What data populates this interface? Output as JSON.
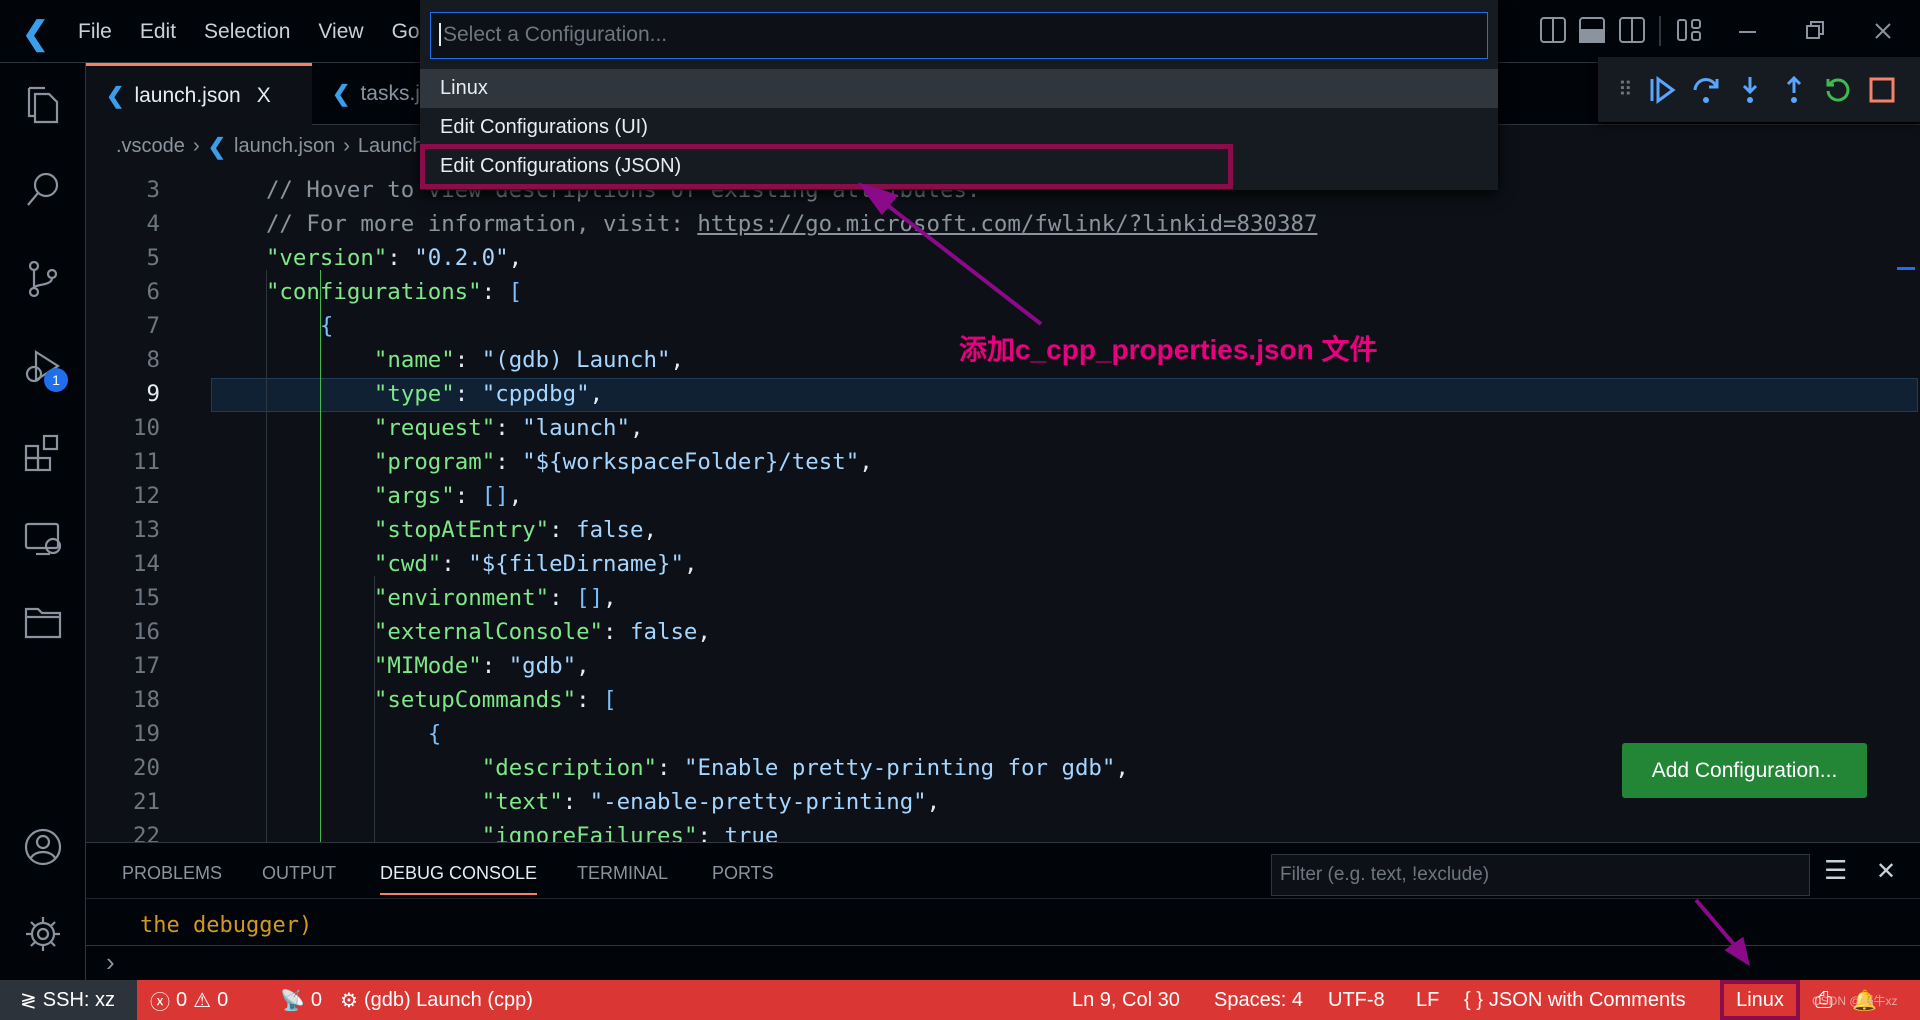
{
  "titlebar": {
    "menu": [
      "File",
      "Edit",
      "Selection",
      "View",
      "Go"
    ]
  },
  "tabs": [
    {
      "label": "launch.json",
      "active": true,
      "close": "X"
    },
    {
      "label": "tasks.json",
      "active": false
    }
  ],
  "breadcrumb": [
    ".vscode",
    "launch.json",
    "Launch"
  ],
  "quick_pick": {
    "placeholder": "Select a Configuration...",
    "items": [
      "Linux",
      "Edit Configurations (UI)",
      "Edit Configurations (JSON)"
    ]
  },
  "annotation": "添加c_cpp_properties.json 文件",
  "activity_badge": "1",
  "editor": {
    "current_line": 9,
    "lines": [
      {
        "n": 3,
        "i": 4,
        "t": [
          [
            "cm",
            "// Hover to view descriptions of existing attributes."
          ]
        ]
      },
      {
        "n": 4,
        "i": 4,
        "t": [
          [
            "cm",
            "// For more information, visit: "
          ],
          [
            "url",
            "https://go.microsoft.com/fwlink/?linkid=830387"
          ]
        ]
      },
      {
        "n": 5,
        "i": 4,
        "t": [
          [
            "key",
            "\"version\""
          ],
          [
            "pun",
            ": "
          ],
          [
            "str",
            "\"0.2.0\""
          ],
          [
            "pun",
            ","
          ]
        ]
      },
      {
        "n": 6,
        "i": 4,
        "t": [
          [
            "key",
            "\"configurations\""
          ],
          [
            "pun",
            ": "
          ],
          [
            "br",
            "["
          ]
        ]
      },
      {
        "n": 7,
        "i": 8,
        "t": [
          [
            "br",
            "{"
          ]
        ]
      },
      {
        "n": 8,
        "i": 12,
        "t": [
          [
            "key",
            "\"name\""
          ],
          [
            "pun",
            ": "
          ],
          [
            "str",
            "\"(gdb) Launch\""
          ],
          [
            "pun",
            ","
          ]
        ]
      },
      {
        "n": 9,
        "i": 12,
        "t": [
          [
            "key",
            "\"type\""
          ],
          [
            "pun",
            ": "
          ],
          [
            "str",
            "\"cppdbg\""
          ],
          [
            "pun",
            ","
          ]
        ]
      },
      {
        "n": 10,
        "i": 12,
        "t": [
          [
            "key",
            "\"request\""
          ],
          [
            "pun",
            ": "
          ],
          [
            "str",
            "\"launch\""
          ],
          [
            "pun",
            ","
          ]
        ]
      },
      {
        "n": 11,
        "i": 12,
        "t": [
          [
            "key",
            "\"program\""
          ],
          [
            "pun",
            ": "
          ],
          [
            "str",
            "\"${workspaceFolder}/test\""
          ],
          [
            "pun",
            ","
          ]
        ]
      },
      {
        "n": 12,
        "i": 12,
        "t": [
          [
            "key",
            "\"args\""
          ],
          [
            "pun",
            ": "
          ],
          [
            "br",
            "[]"
          ],
          [
            "pun",
            ","
          ]
        ]
      },
      {
        "n": 13,
        "i": 12,
        "t": [
          [
            "key",
            "\"stopAtEntry\""
          ],
          [
            "pun",
            ": "
          ],
          [
            "str",
            "false"
          ],
          [
            "pun",
            ","
          ]
        ]
      },
      {
        "n": 14,
        "i": 12,
        "t": [
          [
            "key",
            "\"cwd\""
          ],
          [
            "pun",
            ": "
          ],
          [
            "str",
            "\"${fileDirname}\""
          ],
          [
            "pun",
            ","
          ]
        ]
      },
      {
        "n": 15,
        "i": 12,
        "t": [
          [
            "key",
            "\"environment\""
          ],
          [
            "pun",
            ": "
          ],
          [
            "br",
            "[]"
          ],
          [
            "pun",
            ","
          ]
        ]
      },
      {
        "n": 16,
        "i": 12,
        "t": [
          [
            "key",
            "\"externalConsole\""
          ],
          [
            "pun",
            ": "
          ],
          [
            "str",
            "false"
          ],
          [
            "pun",
            ","
          ]
        ]
      },
      {
        "n": 17,
        "i": 12,
        "t": [
          [
            "key",
            "\"MIMode\""
          ],
          [
            "pun",
            ": "
          ],
          [
            "str",
            "\"gdb\""
          ],
          [
            "pun",
            ","
          ]
        ]
      },
      {
        "n": 18,
        "i": 12,
        "t": [
          [
            "key",
            "\"setupCommands\""
          ],
          [
            "pun",
            ": "
          ],
          [
            "br",
            "["
          ]
        ]
      },
      {
        "n": 19,
        "i": 16,
        "t": [
          [
            "br",
            "{"
          ]
        ]
      },
      {
        "n": 20,
        "i": 20,
        "t": [
          [
            "key",
            "\"description\""
          ],
          [
            "pun",
            ": "
          ],
          [
            "str",
            "\"Enable pretty-printing for gdb\""
          ],
          [
            "pun",
            ","
          ]
        ]
      },
      {
        "n": 21,
        "i": 20,
        "t": [
          [
            "key",
            "\"text\""
          ],
          [
            "pun",
            ": "
          ],
          [
            "str",
            "\"-enable-pretty-printing\""
          ],
          [
            "pun",
            ","
          ]
        ]
      },
      {
        "n": 22,
        "i": 20,
        "t": [
          [
            "key",
            "\"ignoreFailures\""
          ],
          [
            "pun",
            ": "
          ],
          [
            "str",
            "true"
          ]
        ]
      }
    ]
  },
  "add_configuration": "Add Configuration...",
  "panel": {
    "tabs": [
      "PROBLEMS",
      "OUTPUT",
      "DEBUG CONSOLE",
      "TERMINAL",
      "PORTS"
    ],
    "active": "DEBUG CONSOLE",
    "filter_placeholder": "Filter (e.g. text, !exclude)",
    "console_text": "the debugger)",
    "prompt": "›"
  },
  "status": {
    "remote": "SSH: xz",
    "errors": "0",
    "warnings": "0",
    "ports": "0",
    "debug": "(gdb) Launch (cpp)",
    "position": "Ln 9, Col 30",
    "spaces": "Spaces: 4",
    "encoding": "UTF-8",
    "eol": "LF",
    "language": "JSON with Comments",
    "config": "Linux",
    "watermark": "CSDN @蜗牛xz"
  },
  "colors": {
    "statusbar": "#da3633",
    "remote": "#2d333b",
    "accent": "#f78166",
    "highlight_box": "#8a0d4a",
    "annotation": "#e8007f",
    "button": "#238636"
  }
}
